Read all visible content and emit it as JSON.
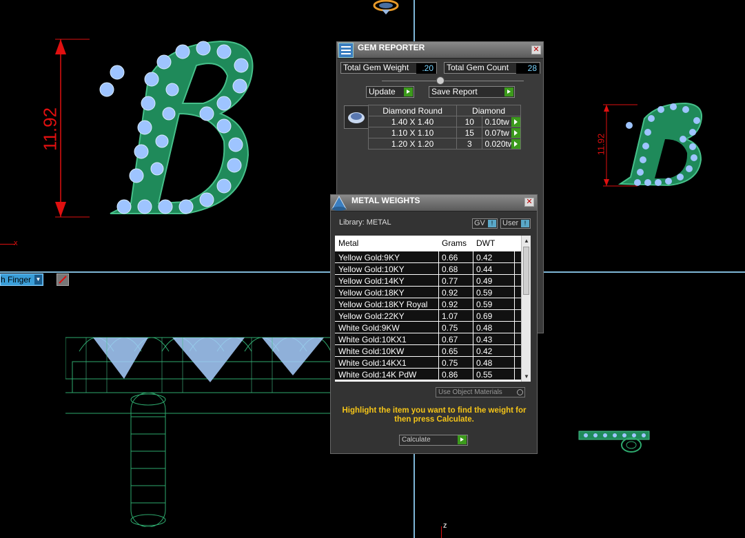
{
  "viewport": {
    "dimension_large": "11.92",
    "dimension_small": "11.92",
    "axis_x_label": "x",
    "axis_z_label": "z",
    "view_selector": "h Finger"
  },
  "gem_reporter": {
    "title": "GEM REPORTER",
    "total_weight_label": "Total Gem Weight",
    "total_weight_value": ".20",
    "total_count_label": "Total Gem Count",
    "total_count_value": "28",
    "update_label": "Update",
    "save_report_label": "Save Report",
    "table_headers": [
      "Diamond Round",
      "Diamond"
    ],
    "rows": [
      {
        "size": "1.40 X 1.40",
        "count": "10",
        "weight": "0.10tw"
      },
      {
        "size": "1.10 X 1.10",
        "count": "15",
        "weight": "0.07tw"
      },
      {
        "size": "1.20 X 1.20",
        "count": "3",
        "weight": "0.020tw"
      }
    ]
  },
  "metal_weights": {
    "title": "METAL WEIGHTS",
    "library_label": "Library: METAL",
    "gv_label": "GV",
    "user_label": "User",
    "columns": [
      "Metal",
      "Grams",
      "DWT"
    ],
    "rows": [
      {
        "metal": "Yellow Gold:9KY",
        "grams": "0.66",
        "dwt": "0.42"
      },
      {
        "metal": "Yellow Gold:10KY",
        "grams": "0.68",
        "dwt": "0.44"
      },
      {
        "metal": "Yellow Gold:14KY",
        "grams": "0.77",
        "dwt": "0.49"
      },
      {
        "metal": "Yellow Gold:18KY",
        "grams": "0.92",
        "dwt": "0.59"
      },
      {
        "metal": "Yellow Gold:18KY Royal",
        "grams": "0.92",
        "dwt": "0.59"
      },
      {
        "metal": "Yellow Gold:22KY",
        "grams": "1.07",
        "dwt": "0.69"
      },
      {
        "metal": "White Gold:9KW",
        "grams": "0.75",
        "dwt": "0.48"
      },
      {
        "metal": "White Gold:10KX1",
        "grams": "0.67",
        "dwt": "0.43"
      },
      {
        "metal": "White Gold:10KW",
        "grams": "0.65",
        "dwt": "0.42"
      },
      {
        "metal": "White Gold:14KX1",
        "grams": "0.75",
        "dwt": "0.48"
      },
      {
        "metal": "White Gold:14K PdW",
        "grams": "0.86",
        "dwt": "0.55"
      }
    ],
    "use_object_materials_label": "Use Object Materials",
    "hint": "Highlight the item you want to find the weight for then press Calculate.",
    "calculate_label": "Calculate"
  },
  "colors": {
    "accent_green": "#3c9a1c",
    "hint_yellow": "#f5c518",
    "value_blue": "#7cd6ff",
    "dimension_red": "#e01010",
    "model_green": "#2eaa6e",
    "gem_blue": "#8ec8ff"
  }
}
